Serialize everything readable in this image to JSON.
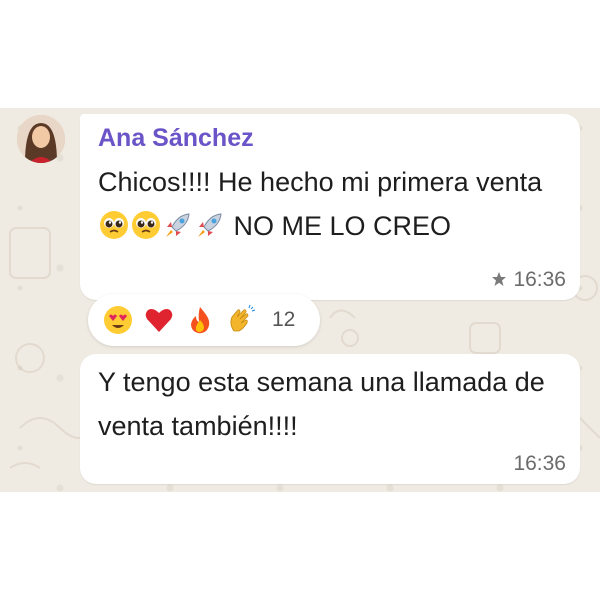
{
  "messages": [
    {
      "sender": "Ana Sánchez",
      "text_part1": "Chicos!!!! He hecho mi primera venta",
      "text_part2": " NO ME LO CREO",
      "inline_emojis": [
        "pleading-face-icon",
        "pleading-face-icon",
        "rocket-icon",
        "rocket-icon"
      ],
      "time": "16:36",
      "starred": true,
      "reactions": {
        "emojis": [
          "heart-eyes-icon",
          "red-heart-icon",
          "fire-icon",
          "clapping-hands-icon"
        ],
        "count": "12"
      }
    },
    {
      "text": "Y tengo esta semana una llamada de venta también!!!!",
      "time": "16:36"
    }
  ],
  "colors": {
    "sender_name": "#6a54c8",
    "chat_background": "#efeae2",
    "bubble": "#ffffff",
    "timestamp": "#6b6b6b"
  }
}
